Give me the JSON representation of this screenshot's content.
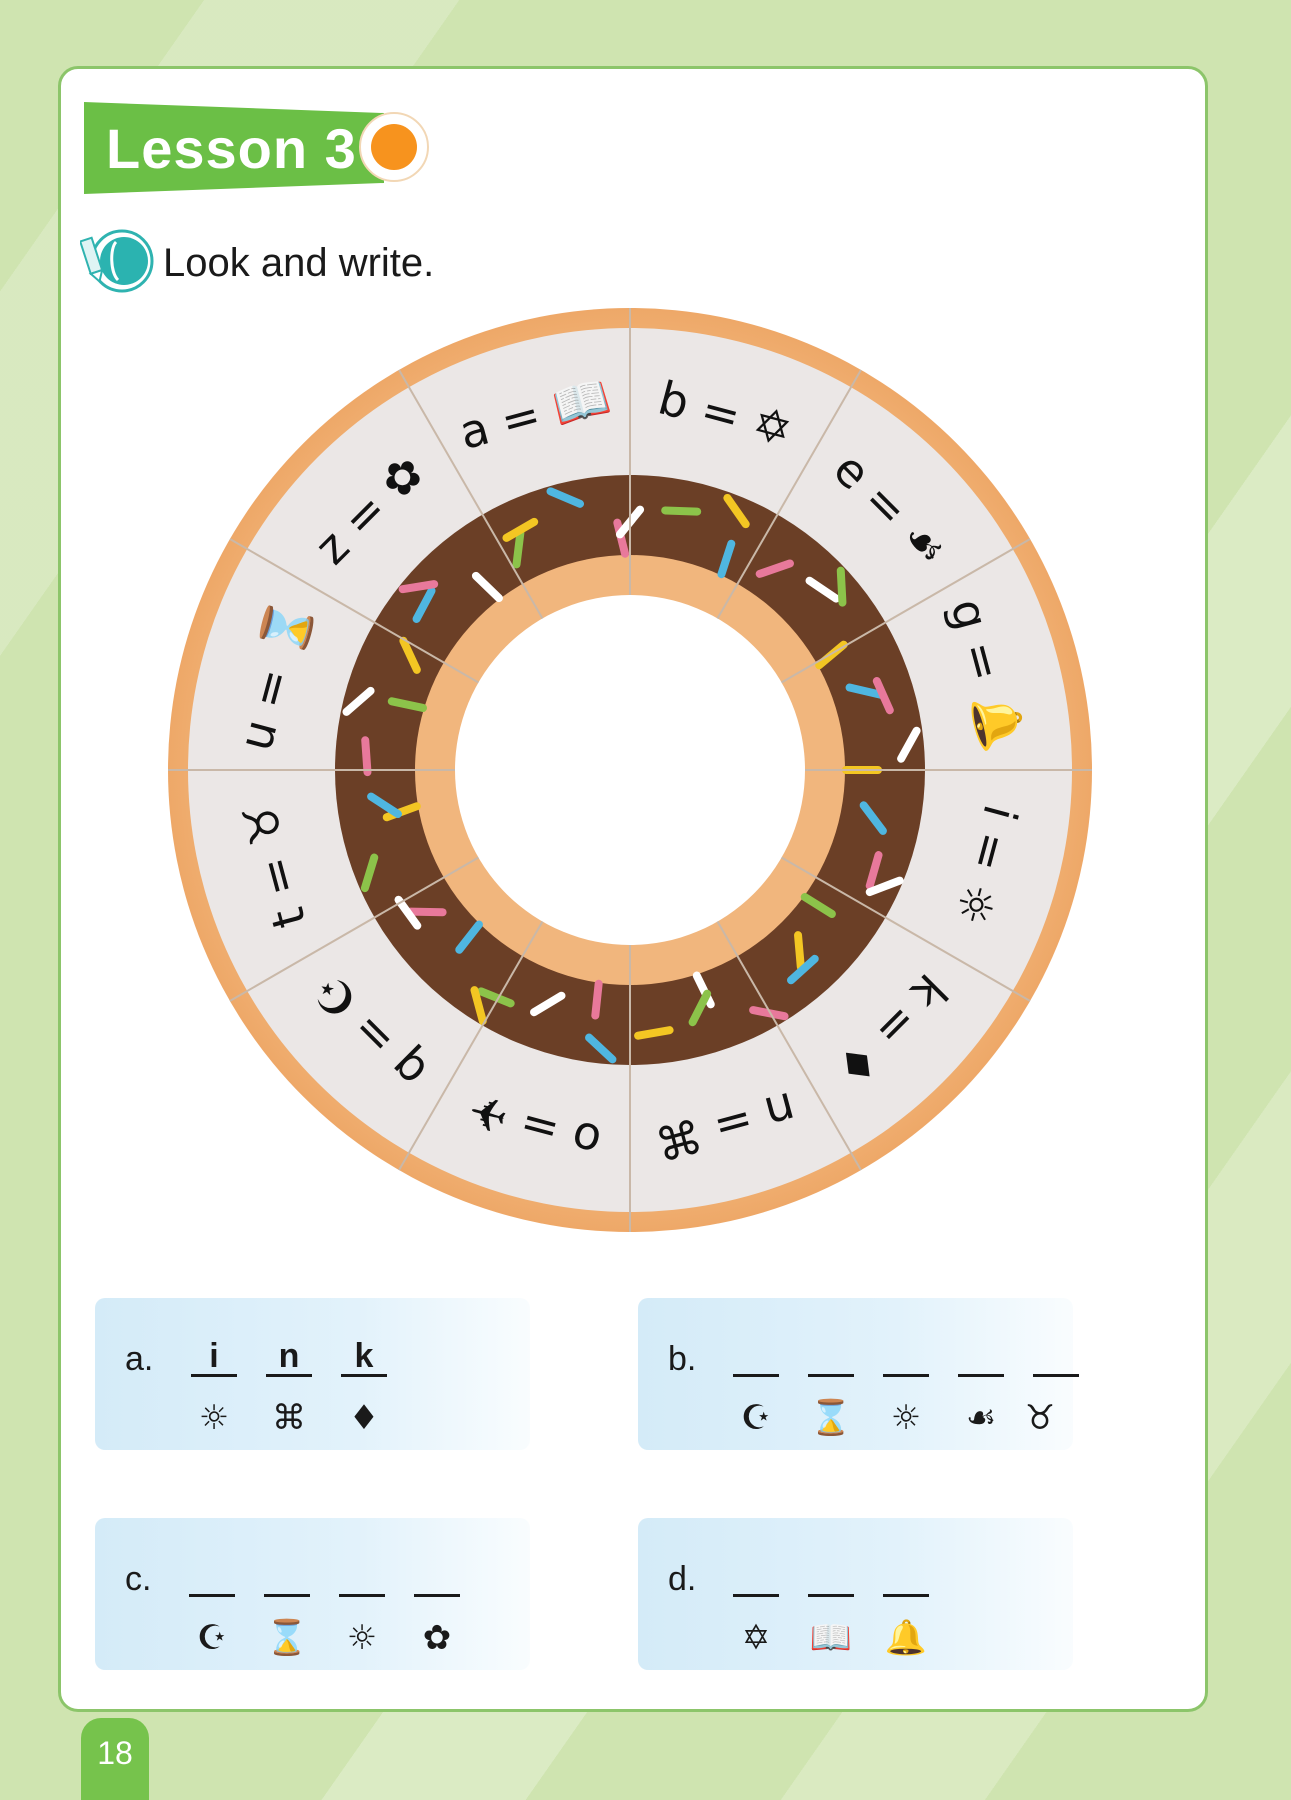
{
  "lesson": {
    "title": "Lesson 3"
  },
  "instruction": "Look and write.",
  "key": [
    {
      "letter": "a",
      "icon": "open-book",
      "glyph": "📖"
    },
    {
      "letter": "b",
      "icon": "star-of-david",
      "glyph": "✡"
    },
    {
      "letter": "e",
      "icon": "floral-heart",
      "glyph": "☙"
    },
    {
      "letter": "g",
      "icon": "bell",
      "glyph": "🔔"
    },
    {
      "letter": "i",
      "icon": "sun",
      "glyph": "☼"
    },
    {
      "letter": "k",
      "icon": "black-diamond",
      "glyph": "♦"
    },
    {
      "letter": "n",
      "icon": "place-of-interest",
      "glyph": "⌘"
    },
    {
      "letter": "o",
      "icon": "airplane",
      "glyph": "✈"
    },
    {
      "letter": "q",
      "icon": "star-and-crescent",
      "glyph": "☪"
    },
    {
      "letter": "t",
      "icon": "taurus",
      "glyph": "♉"
    },
    {
      "letter": "u",
      "icon": "hourglass",
      "glyph": "⌛"
    },
    {
      "letter": "z",
      "icon": "flower",
      "glyph": "✿"
    }
  ],
  "equals": "=",
  "exercises": [
    {
      "label": "a.",
      "answers": [
        "i",
        "n",
        "k"
      ],
      "symbols": [
        "☼",
        "⌘",
        "♦"
      ]
    },
    {
      "label": "b.",
      "answers": [
        "",
        "",
        "",
        "",
        ""
      ],
      "symbols": [
        "☪",
        "⌛",
        "☼",
        "☙",
        "♉"
      ]
    },
    {
      "label": "c.",
      "answers": [
        "",
        "",
        "",
        ""
      ],
      "symbols": [
        "☪",
        "⌛",
        "☼",
        "✿"
      ]
    },
    {
      "label": "d.",
      "answers": [
        "",
        "",
        ""
      ],
      "symbols": [
        "✡",
        "📖",
        "🔔"
      ]
    }
  ],
  "page_number": "18",
  "colors": {
    "background": "#cfe4b0",
    "card_border": "#8cc56a",
    "banner": "#6bbf46",
    "accent_dot": "#f7931e",
    "donut_dough": "#f4b97a",
    "donut_icing": "#eae6e4",
    "donut_chocolate": "#6b3f26",
    "exercise_bg": "#d4ebf8"
  }
}
